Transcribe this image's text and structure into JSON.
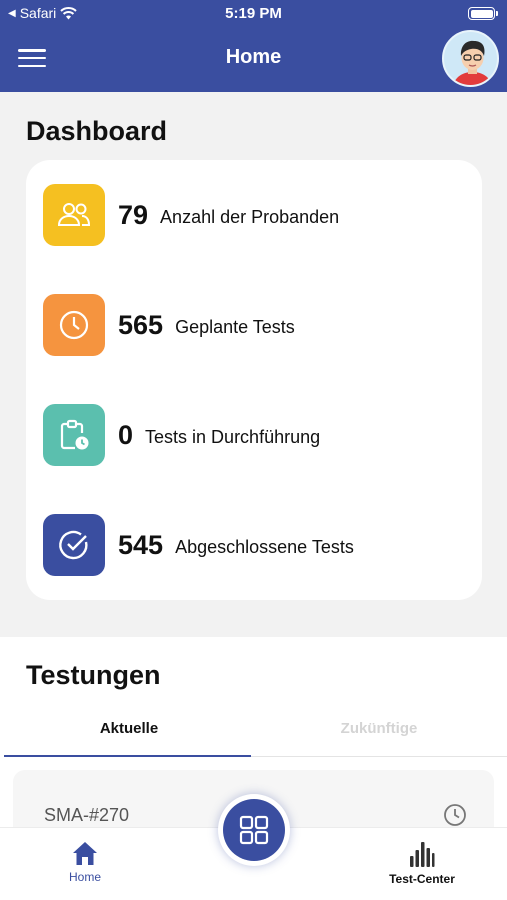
{
  "status_bar": {
    "back_app": "Safari",
    "time": "5:19 PM"
  },
  "header": {
    "title": "Home",
    "menu_icon": "hamburger-menu-icon",
    "avatar_icon": "user-avatar"
  },
  "dashboard": {
    "title": "Dashboard",
    "stats": [
      {
        "value": "79",
        "label": "Anzahl der Probanden",
        "color": "#f5c021",
        "icon": "users-icon"
      },
      {
        "value": "565",
        "label": "Geplante Tests",
        "color": "#f5943f",
        "icon": "clock-icon"
      },
      {
        "value": "0",
        "label": "Tests in Durchführung",
        "color": "#5bbfae",
        "icon": "clipboard-clock-icon"
      },
      {
        "value": "545",
        "label": "Abgeschlossene Tests",
        "color": "#3a4ea0",
        "icon": "check-circle-icon"
      }
    ]
  },
  "testungen": {
    "title": "Testungen",
    "tabs": [
      {
        "label": "Aktuelle",
        "active": true
      },
      {
        "label": "Zukünftige",
        "active": false
      }
    ],
    "items": [
      {
        "id": "SMA-#270",
        "icon": "clock-icon"
      }
    ]
  },
  "bottom_nav": {
    "items": [
      {
        "label": "Home",
        "icon": "home-icon",
        "active": true
      },
      {
        "label": "Test-Center",
        "icon": "bar-chart-icon",
        "active": false
      }
    ],
    "fab_icon": "grid-icon"
  },
  "colors": {
    "primary": "#3a4ea0",
    "background": "#f2f2f2"
  }
}
